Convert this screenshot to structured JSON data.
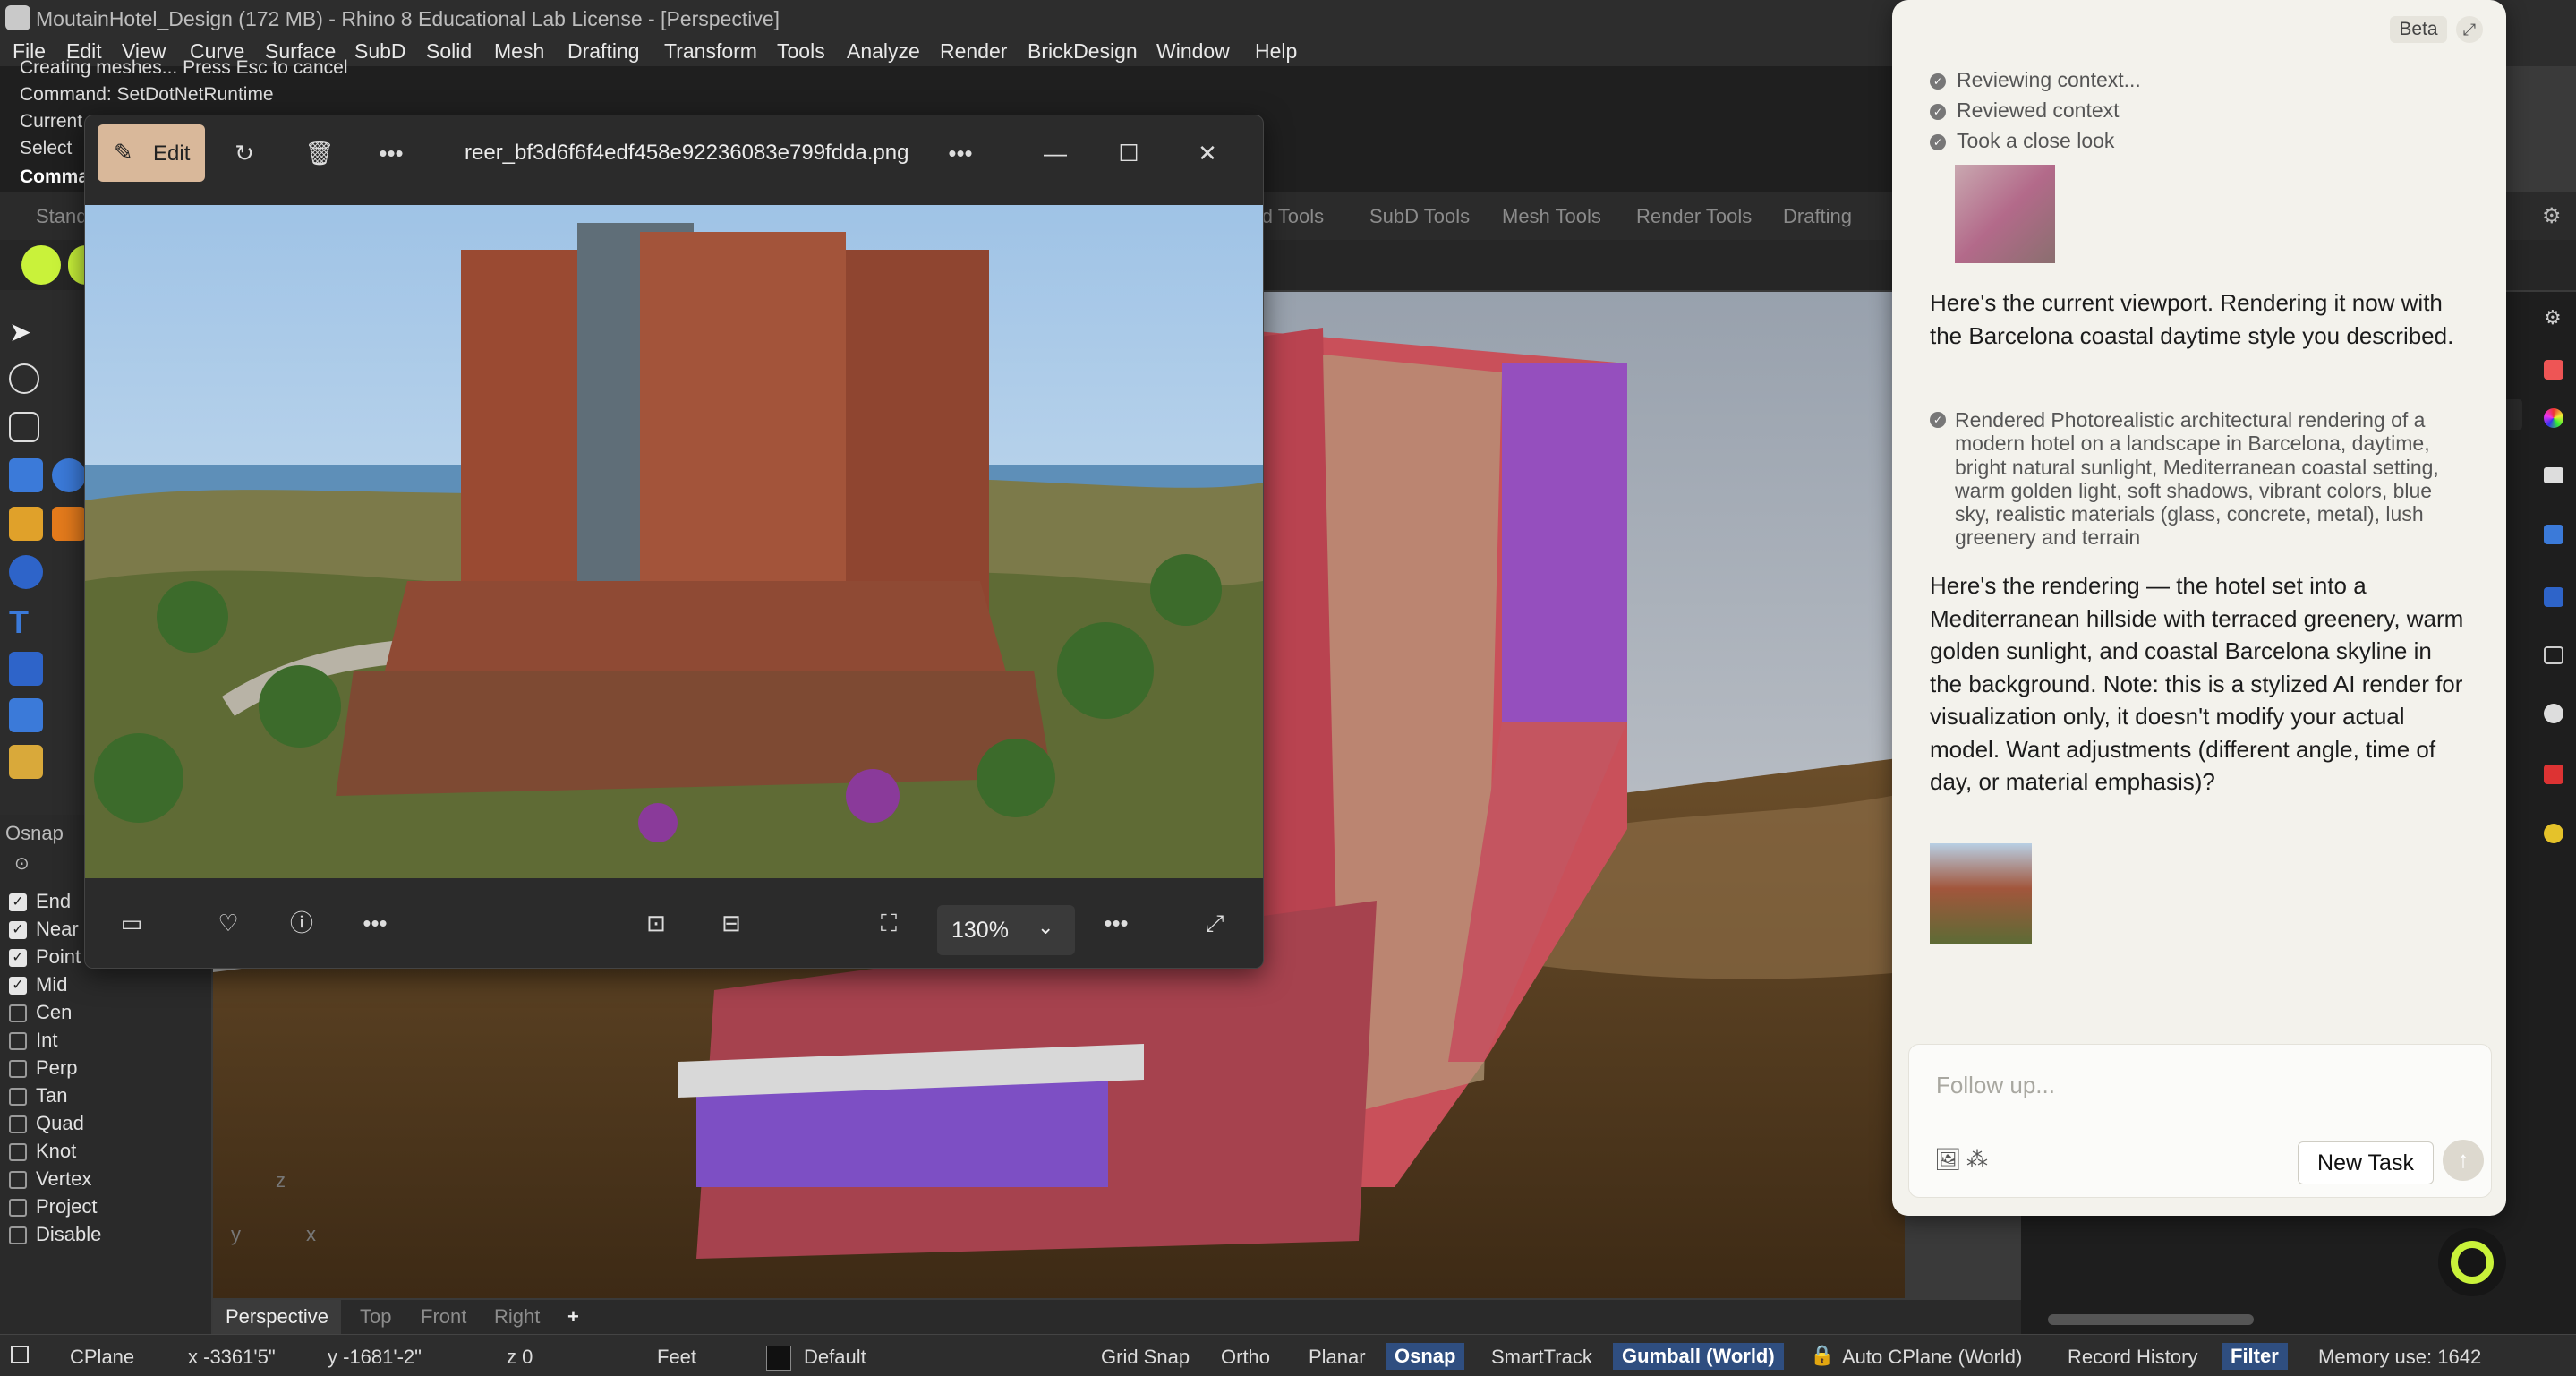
{
  "window": {
    "title": "MoutainHotel_Design (172 MB) - Rhino 8 Educational Lab License - [Perspective]",
    "menu": [
      "File",
      "Edit",
      "View",
      "Curve",
      "Surface",
      "SubD",
      "Solid",
      "Mesh",
      "Drafting",
      "Transform",
      "Tools",
      "Analyze",
      "Render",
      "BrickDesign",
      "Window",
      "Help"
    ]
  },
  "command": {
    "lines": [
      "Creating meshes... Press Esc to cancel",
      "Command: SetDotNetRuntime",
      "Current",
      "Select",
      "Comma"
    ]
  },
  "toolbar_tabs": [
    "Stand",
    "lid Tools",
    "SubD Tools",
    "Mesh Tools",
    "Render Tools",
    "Drafting"
  ],
  "osnap": {
    "title": "Osnap",
    "items": [
      {
        "label": "End",
        "checked": true
      },
      {
        "label": "Near",
        "checked": true
      },
      {
        "label": "Point",
        "checked": true
      },
      {
        "label": "Mid",
        "checked": true
      },
      {
        "label": "Cen",
        "checked": false
      },
      {
        "label": "Int",
        "checked": false
      },
      {
        "label": "Perp",
        "checked": false
      },
      {
        "label": "Tan",
        "checked": false
      },
      {
        "label": "Quad",
        "checked": false
      },
      {
        "label": "Knot",
        "checked": false
      },
      {
        "label": "Vertex",
        "checked": false
      },
      {
        "label": "Project",
        "checked": false
      },
      {
        "label": "Disable",
        "checked": false
      }
    ]
  },
  "viewport": {
    "axis_z": "z",
    "axis_y": "y",
    "axis_x": "x",
    "tabs": [
      "Perspective",
      "Top",
      "Front",
      "Right"
    ],
    "add_tab": "+"
  },
  "statusbar": {
    "cplane": "CPlane",
    "x": "x -3361'5\"",
    "y": "y -1681'-2\"",
    "z": "z 0",
    "units": "Feet",
    "layer": "Default",
    "grid_snap": "Grid Snap",
    "ortho": "Ortho",
    "planar": "Planar",
    "osnap": "Osnap",
    "smarttrack": "SmartTrack",
    "gumball": "Gumball (World)",
    "auto_cplane": "Auto CPlane (World)",
    "record_history": "Record History",
    "filter": "Filter",
    "memory": "Memory use: 1642"
  },
  "viewer": {
    "edit_label": "Edit",
    "filename": "reer_bf3d6f6f4edf458e92236083e799fdda.png",
    "zoom": "130%"
  },
  "chat": {
    "beta": "Beta",
    "steps": [
      "Reviewing context...",
      "Reviewed context",
      "Took a close look"
    ],
    "msg1": "Here's the current viewport. Rendering it now with the Barcelona coastal daytime style you described.",
    "rendered": "Rendered Photorealistic architectural rendering of a modern hotel on a landscape in Barcelona, daytime, bright natural sunlight, Mediterranean coastal setting, warm golden light, soft shadows, vibrant colors, blue sky, realistic materials (glass, concrete, metal), lush greenery and terrain",
    "msg2": "Here's the rendering — the hotel set into a Mediterranean hillside with terraced greenery, warm golden sunlight, and coastal Barcelona skyline in the background. Note: this is a stylized AI render for visualization only, it doesn't modify your actual model. Want adjustments (different angle, time of day, or material emphasis)?",
    "followup_placeholder": "Follow up...",
    "new_task": "New Task"
  },
  "colors": {
    "accent_edit": "#d9b89a",
    "highlight_blue": "#2f4e80",
    "chat_bg": "#f3f2ec",
    "brand_lime": "#c9f23a"
  }
}
